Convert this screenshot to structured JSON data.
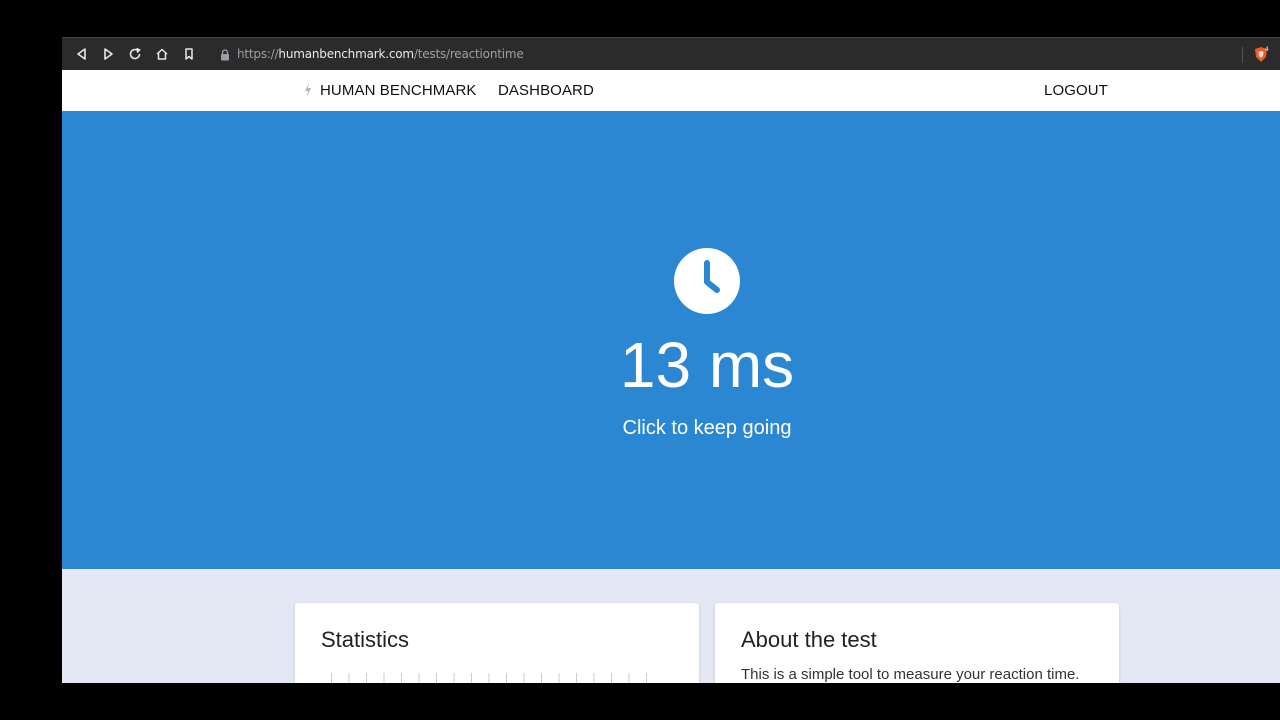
{
  "browser": {
    "url_prefix": "https://",
    "url_host": "humanbenchmark.com",
    "url_path": "/tests/reactiontime",
    "brave_badge_count": "4"
  },
  "nav": {
    "brand": "HUMAN BENCHMARK",
    "dashboard": "DASHBOARD",
    "logout": "LOGOUT"
  },
  "hero": {
    "result": "13 ms",
    "hint": "Click to keep going",
    "background_color": "#2b87d1"
  },
  "cards": {
    "statistics_title": "Statistics",
    "about_title": "About the test",
    "about_text": "This is a simple tool to measure your reaction time."
  }
}
